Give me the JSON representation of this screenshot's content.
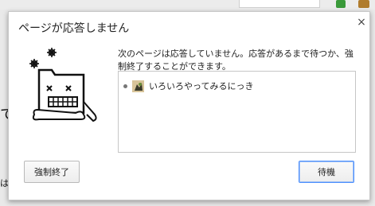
{
  "dialog": {
    "title": "ページが応答しません",
    "message": "次のページは応答していません。応答があるまで待つか、強制終了することができます。",
    "pages": [
      {
        "title": "いろいろやってみるにっき"
      }
    ],
    "buttons": {
      "kill": "強制終了",
      "wait": "待機"
    },
    "close_glyph": "×"
  },
  "background": {
    "glyph_1": "て",
    "glyph_2": "は"
  },
  "colors": {
    "accent": "#4d90fe"
  }
}
